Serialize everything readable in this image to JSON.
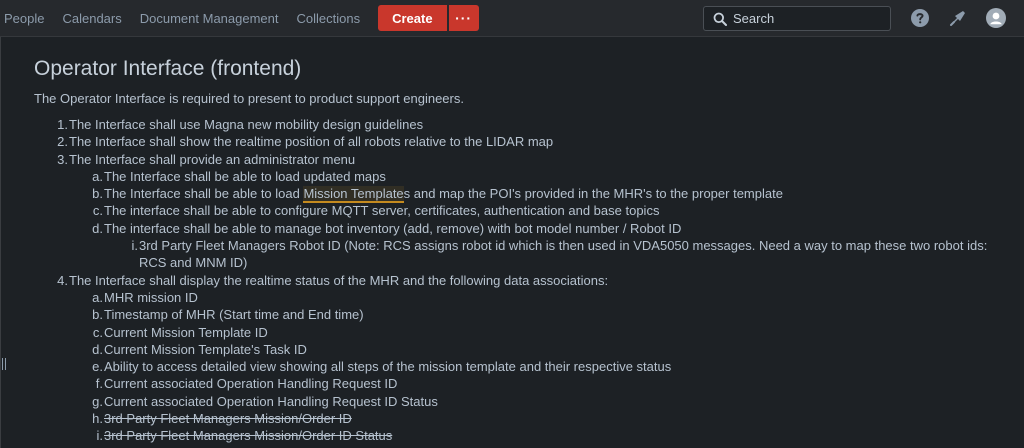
{
  "nav": {
    "items": [
      "People",
      "Calendars",
      "Document Management",
      "Collections"
    ],
    "create_label": "Create",
    "more_label": "···"
  },
  "search": {
    "placeholder": "Search"
  },
  "colors": {
    "accent": "#c9372c",
    "highlight": "#c48a1f",
    "background": "#1d2125"
  },
  "icons": [
    "search-icon",
    "help-icon",
    "notifications-icon",
    "avatar-icon"
  ],
  "page": {
    "title": "Operator Interface (frontend)",
    "intro": "The Operator Interface is required to present to product support engineers.",
    "req1": {
      "num": "1.",
      "text": "The Interface shall use Magna new mobility design guidelines"
    },
    "req2": {
      "num": "2.",
      "text": "The Interface shall show the realtime position of all robots relative to the LIDAR map"
    },
    "req3": {
      "num": "3.",
      "text": "The Interface shall provide an administrator menu",
      "a": {
        "num": "a.",
        "text": "The Interface shall be able to load updated maps"
      },
      "b": {
        "num": "b.",
        "pre": "The Interface shall be able to load ",
        "highlight": "Mission Template",
        "post": "s and map the POI's provided in the MHR's to the proper template"
      },
      "c": {
        "num": "c.",
        "text": "The interface shall be able to configure MQTT server, certificates, authentication and base topics"
      },
      "d": {
        "num": "d.",
        "text": "The interface shall be able to manage bot inventory (add, remove) with bot model number / Robot ID",
        "i": {
          "num": "i.",
          "text": "3rd Party Fleet Managers Robot ID (Note: RCS assigns robot id which is then used in VDA5050 messages. Need a way to map these two robot ids: RCS and MNM ID)"
        }
      }
    },
    "req4": {
      "num": "4.",
      "text": "The Interface shall display the realtime status of the MHR and the following data associations:",
      "a": {
        "num": "a.",
        "text": "MHR mission ID"
      },
      "b": {
        "num": "b.",
        "text": "Timestamp of MHR (Start time and End time)"
      },
      "c": {
        "num": "c.",
        "text": "Current Mission Template ID"
      },
      "d": {
        "num": "d.",
        "text": "Current Mission Template's Task ID"
      },
      "e": {
        "num": "e.",
        "text": "Ability to access detailed view showing all steps of the mission template and their respective status"
      },
      "f": {
        "num": "f.",
        "text": "Current associated Operation Handling Request ID"
      },
      "g": {
        "num": "g.",
        "text": "Current associated Operation Handling Request ID Status"
      },
      "h": {
        "num": "h.",
        "text": "3rd Party Fleet Managers Mission/Order ID"
      },
      "i": {
        "num": "i.",
        "text": "3rd Party Fleet Managers Mission/Order ID Status"
      }
    }
  }
}
